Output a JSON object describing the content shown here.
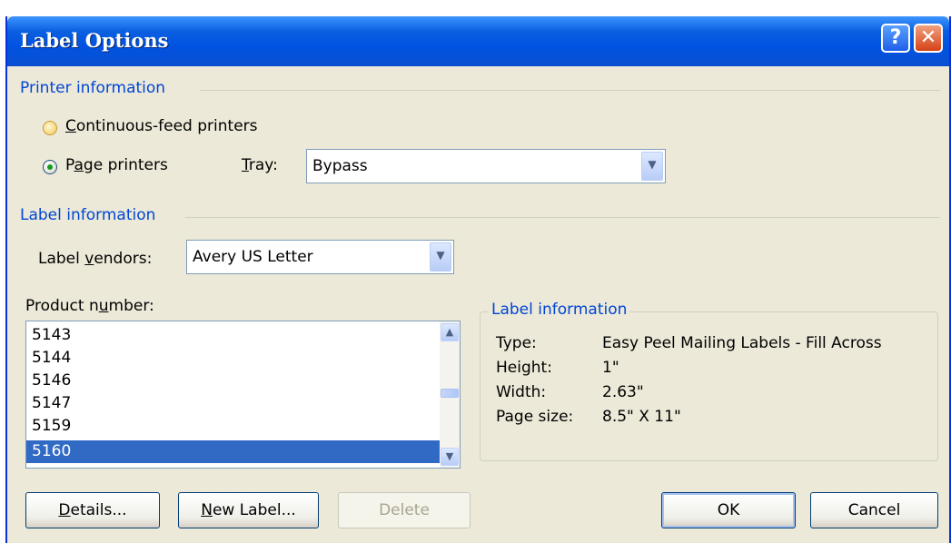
{
  "window": {
    "title": "Label Options",
    "help_glyph": "?",
    "close_glyph": "✕"
  },
  "printer_info": {
    "heading": "Printer information",
    "continuous_feed": {
      "accel": "C",
      "rest": "ontinuous-feed printers",
      "selected": false
    },
    "page_printers": {
      "pre": "P",
      "accel": "a",
      "rest": "ge printers",
      "selected": true
    },
    "tray_label": {
      "accel": "T",
      "rest": "ray:"
    },
    "tray_value": "Bypass"
  },
  "label_info": {
    "heading": "Label information",
    "vendors_label": {
      "pre": "Label ",
      "accel": "v",
      "rest": "endors:"
    },
    "vendors_value": "Avery US Letter",
    "product_label": {
      "pre": "Product n",
      "accel": "u",
      "rest": "mber:"
    },
    "products": [
      "5143",
      "5144",
      "5146",
      "5147",
      "5159",
      "5160"
    ],
    "selected_product": "5160"
  },
  "details": {
    "heading": "Label information",
    "type_label": "Type:",
    "type_value": "Easy Peel Mailing Labels - Fill Across",
    "height_label": "Height:",
    "height_value": "1\"",
    "width_label": "Width:",
    "width_value": "2.63\"",
    "pagesize_label": "Page size:",
    "pagesize_value": "8.5\" X 11\""
  },
  "buttons": {
    "details": {
      "accel": "D",
      "rest": "etails..."
    },
    "new_label": {
      "accel": "N",
      "rest": "ew Label..."
    },
    "delete": "Delete",
    "ok": "OK",
    "cancel": "Cancel"
  },
  "colors": {
    "title_bar": "#0053e1",
    "group_heading": "#0046d5",
    "selection": "#316ac5",
    "dialog_bg": "#ece9d8"
  }
}
